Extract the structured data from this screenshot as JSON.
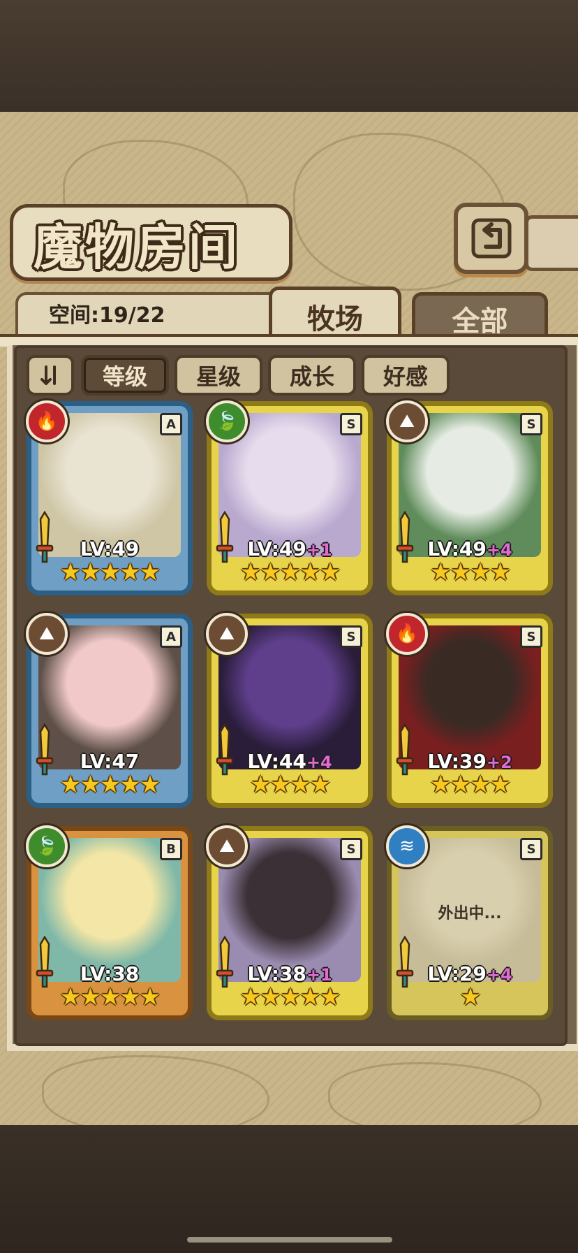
{
  "header": {
    "title": "魔物房间",
    "back_icon": "back-arrow-icon"
  },
  "space": {
    "label": "空间:19/22"
  },
  "tabs": [
    {
      "label": "牧场",
      "active": true
    },
    {
      "label": "全部",
      "active": false
    }
  ],
  "sort": {
    "order_icon": "sort-order-icon",
    "buttons": [
      {
        "label": "等级",
        "active": true
      },
      {
        "label": "星级",
        "active": false
      },
      {
        "label": "成长",
        "active": false
      },
      {
        "label": "好感",
        "active": false
      }
    ]
  },
  "monsters": [
    {
      "element": "fire",
      "rank": "A",
      "level": "LV:49",
      "plus": "",
      "stars": "★★★★★",
      "palette": [
        "#e9e3d2",
        "#cfc6a6"
      ]
    },
    {
      "element": "nature",
      "rank": "S",
      "level": "LV:49",
      "plus": "+1",
      "stars": "★★★★★",
      "palette": [
        "#e7dced",
        "#b9a9cf"
      ]
    },
    {
      "element": "earth",
      "rank": "S",
      "level": "LV:49",
      "plus": "+4",
      "stars": "★★★★",
      "palette": [
        "#e6ece4",
        "#5f8c5a"
      ]
    },
    {
      "element": "earth",
      "rank": "A",
      "level": "LV:47",
      "plus": "",
      "stars": "★★★★★",
      "palette": [
        "#f1c9c9",
        "#5e5048"
      ]
    },
    {
      "element": "earth",
      "rank": "S",
      "level": "LV:44",
      "plus": "+4",
      "stars": "★★★★",
      "palette": [
        "#5f3f8c",
        "#2a1d3a"
      ]
    },
    {
      "element": "fire",
      "rank": "S",
      "level": "LV:39",
      "plus": "+2",
      "stars": "★★★★",
      "palette": [
        "#3a2a24",
        "#7a1f1f"
      ]
    },
    {
      "element": "nature",
      "rank": "B",
      "level": "LV:38",
      "plus": "",
      "stars": "★★★★★",
      "palette": [
        "#f3e6a6",
        "#7fb8a8"
      ]
    },
    {
      "element": "earth",
      "rank": "S",
      "level": "LV:38",
      "plus": "+1",
      "stars": "★★★★★",
      "palette": [
        "#3a3035",
        "#9a8bb0"
      ]
    },
    {
      "element": "water",
      "rank": "S",
      "level": "LV:29",
      "plus": "+4",
      "stars": "★",
      "away_text": "外出中...",
      "palette": [
        "#d9d1bd",
        "#c4baa3"
      ]
    }
  ],
  "colors": {
    "frame_A": "#2c5f86",
    "frame_S": "#8e7a16",
    "frame_B": "#7a4716",
    "star": "#f7c81e",
    "plus_level": "#e06bd6"
  }
}
